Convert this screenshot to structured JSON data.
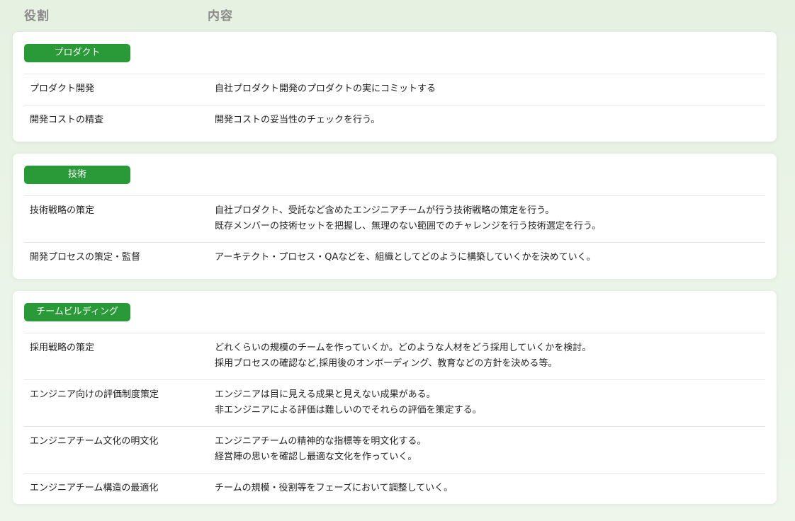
{
  "header": {
    "role_label": "役割",
    "content_label": "内容"
  },
  "colors": {
    "accent": "#2a9a38",
    "background": "#e6f1e2",
    "card": "#ffffff",
    "header_text": "#8a8a8a"
  },
  "sections": [
    {
      "title": "プロダクト",
      "rows": [
        {
          "role": "プロダクト開発",
          "content": [
            "自社プロダクト開発のプロダクトの実にコミットする"
          ]
        },
        {
          "role": "開発コストの精査",
          "content": [
            "開発コストの妥当性のチェックを行う。"
          ]
        }
      ]
    },
    {
      "title": "技術",
      "rows": [
        {
          "role": "技術戦略の策定",
          "content": [
            "自社プロダクト、受託など含めたエンジニアチームが行う技術戦略の策定を行う。",
            "既存メンバーの技術セットを把握し、無理のない範囲でのチャレンジを行う技術選定を行う。"
          ]
        },
        {
          "role": "開発プロセスの策定・監督",
          "content": [
            "アーキテクト・プロセス・QAなどを、組織としてどのように構築していくかを決めていく。"
          ]
        }
      ]
    },
    {
      "title": "チームビルディング",
      "rows": [
        {
          "role": "採用戦略の策定",
          "content": [
            "どれくらいの規模のチームを作っていくか。どのような人材をどう採用していくかを検討。",
            "採用プロセスの確認など,採用後のオンボーディング、教育などの方針を決める等。"
          ]
        },
        {
          "role": "エンジニア向けの評価制度策定",
          "content": [
            "エンジニアは目に見える成果と見えない成果がある。",
            "非エンジニアによる評価は難しいのでそれらの評価を策定する。"
          ]
        },
        {
          "role": "エンジニアチーム文化の明文化",
          "content": [
            "エンジニアチームの精神的な指標等を明文化する。",
            "経営陣の思いを確認し最適な文化を作っていく。"
          ]
        },
        {
          "role": "エンジニアチーム構造の最適化",
          "content": [
            "チームの規模・役割等をフェーズにおいて調整していく。"
          ]
        }
      ]
    }
  ]
}
